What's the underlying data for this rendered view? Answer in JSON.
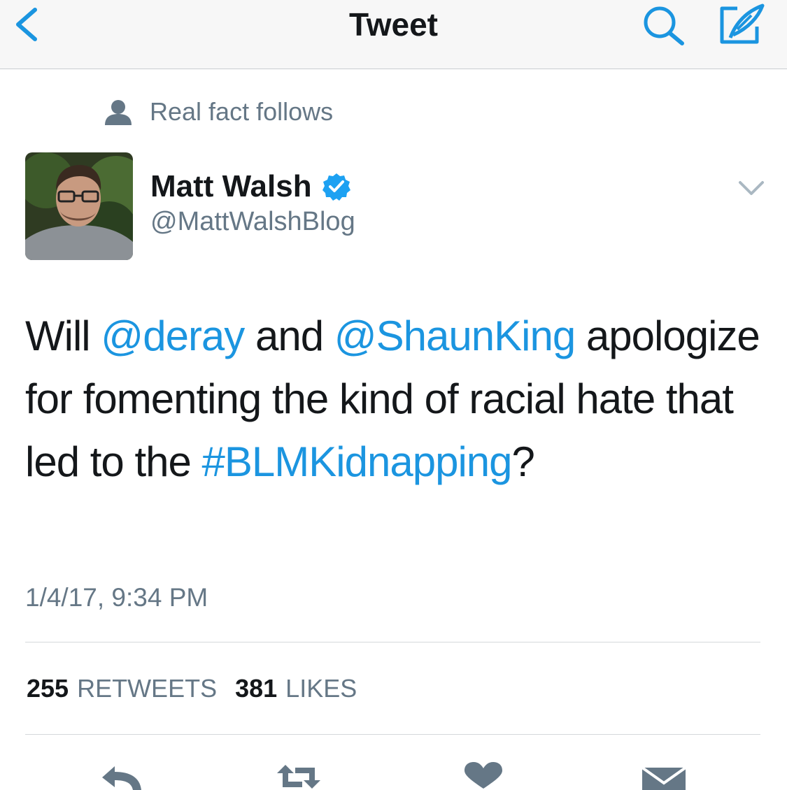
{
  "navbar": {
    "title": "Tweet",
    "accent_color": "#1b95e0"
  },
  "social_context": {
    "icon": "person-icon",
    "text": "Real fact follows"
  },
  "author": {
    "name": "Matt Walsh",
    "handle": "@MattWalshBlog",
    "verified": true,
    "verified_color": "#1da1f2"
  },
  "tweet": {
    "segments": {
      "s1": "Will ",
      "m1": "@deray",
      "s2": " and ",
      "m2": "@ShaunKing",
      "s3": " apologize for fomenting the kind of racial hate that led to the ",
      "h1": "#BLMKidnapping",
      "s4": "?"
    },
    "timestamp": "1/4/17, 9:34 PM"
  },
  "stats": {
    "retweets_count": "255",
    "retweets_label": "RETWEETS",
    "likes_count": "381",
    "likes_label": "LIKES"
  },
  "actions": [
    "reply-icon",
    "retweet-icon",
    "like-icon",
    "direct-message-icon"
  ],
  "colors": {
    "text": "#14171a",
    "secondary": "#657786",
    "link": "#1b95e0"
  }
}
